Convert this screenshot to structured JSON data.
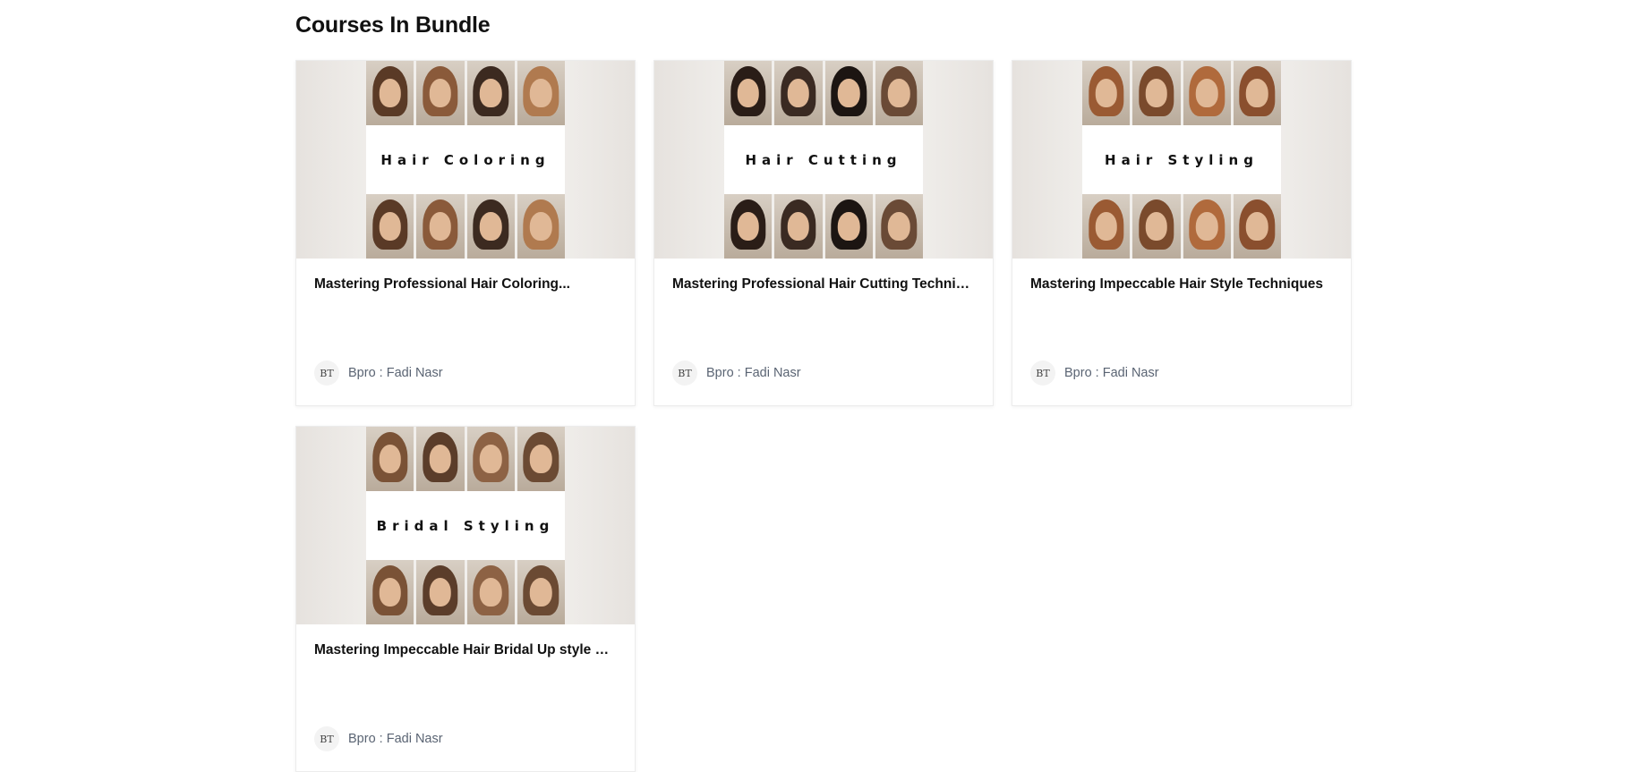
{
  "section": {
    "title": "Courses In Bundle"
  },
  "courses": [
    {
      "image_label": "Hair Coloring",
      "title": "Mastering Professional Hair Coloring...",
      "avatar_text": "BT",
      "author": "Bpro : Fadi Nasr",
      "palette": [
        "#5a3a26",
        "#8a5a3a",
        "#3c2a20",
        "#b07a4f"
      ]
    },
    {
      "image_label": "Hair Cutting",
      "title": "Mastering Professional Hair Cutting Techniques",
      "avatar_text": "BT",
      "author": "Bpro : Fadi Nasr",
      "palette": [
        "#2a1d17",
        "#3a2a22",
        "#1c1512",
        "#6a4a36"
      ]
    },
    {
      "image_label": "Hair Styling",
      "title": "Mastering Impeccable Hair Style Techniques",
      "avatar_text": "BT",
      "author": "Bpro : Fadi Nasr",
      "palette": [
        "#9a5a33",
        "#7a4a2c",
        "#b06a3c",
        "#8a4f2e"
      ]
    },
    {
      "image_label": "Bridal Styling",
      "title": "Mastering Impeccable Hair Bridal Up style wit...",
      "avatar_text": "BT",
      "author": "Bpro : Fadi Nasr",
      "palette": [
        "#7a5236",
        "#5b3d2a",
        "#8d6244",
        "#6b4a33"
      ]
    }
  ]
}
